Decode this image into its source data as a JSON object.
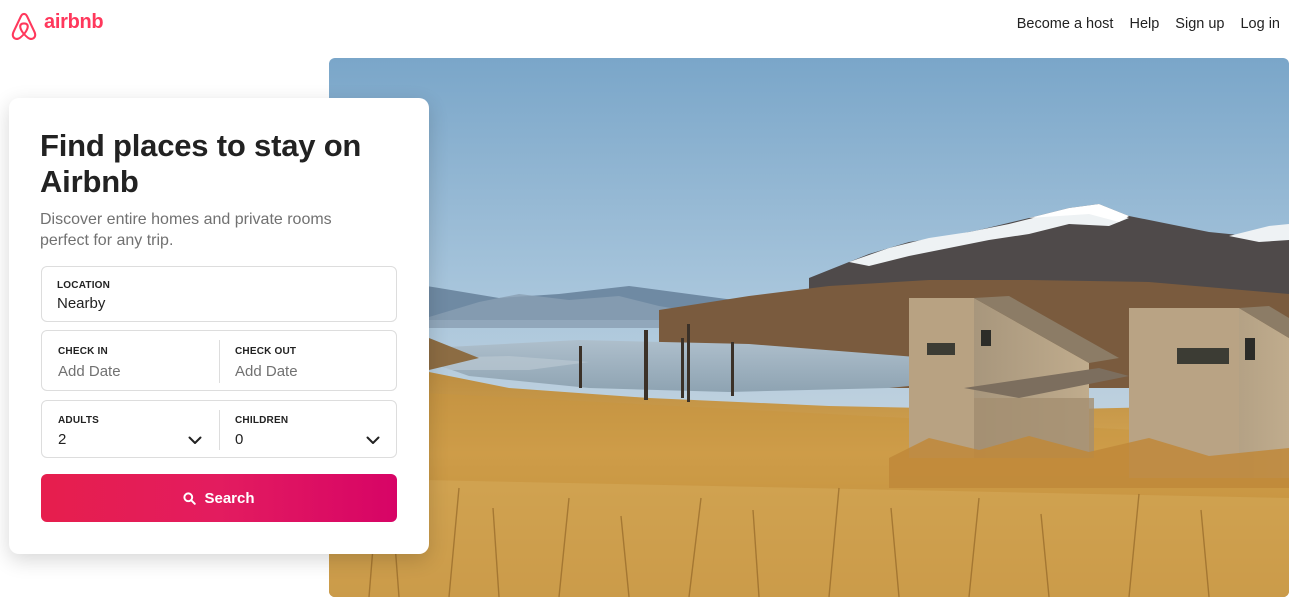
{
  "header": {
    "brand": "airbnb",
    "nav": [
      "Become a host",
      "Help",
      "Sign up",
      "Log in"
    ]
  },
  "card": {
    "title": "Find places to stay on Airbnb",
    "subtitle": "Discover entire homes and private rooms perfect for any trip.",
    "location": {
      "label": "LOCATION",
      "value": "Nearby"
    },
    "check_in": {
      "label": "CHECK IN",
      "placeholder": "Add Date"
    },
    "check_out": {
      "label": "CHECK OUT",
      "placeholder": "Add Date"
    },
    "adults": {
      "label": "ADULTS",
      "value": "2"
    },
    "children": {
      "label": "CHILDREN",
      "value": "0"
    },
    "search_label": "Search"
  },
  "colors": {
    "brand": "#ff385c",
    "button_start": "#e61e4d",
    "button_end": "#d70466"
  },
  "icons": [
    "airbnb-logo-icon",
    "search-icon",
    "chevron-down-icon"
  ]
}
